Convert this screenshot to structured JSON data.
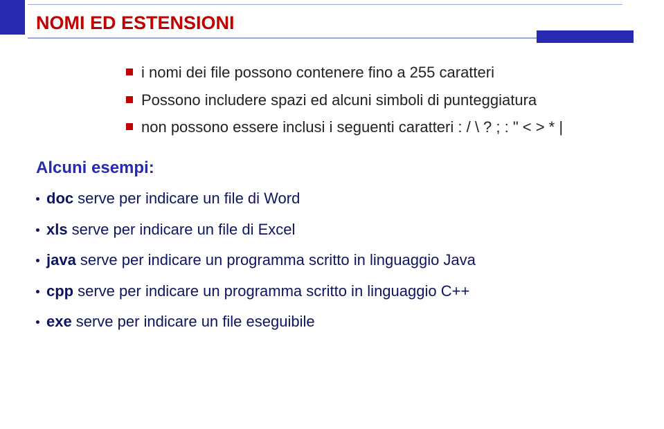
{
  "title": "NOMI ED ESTENSIONI",
  "bullets": [
    "i nomi dei file possono contenere fino a 255 caratteri",
    "Possono includere spazi ed alcuni simboli di punteggiatura",
    "non possono essere inclusi i seguenti caratteri :  / \\ ? ; : \" < > * |"
  ],
  "subheading": "Alcuni esempi:",
  "extensions": [
    {
      "name": "doc",
      "desc": "serve per indicare un file di Word"
    },
    {
      "name": "xls",
      "desc": "serve per indicare un file di Excel"
    },
    {
      "name": "java",
      "desc": "serve per indicare un programma scritto in linguaggio Java"
    },
    {
      "name": "cpp",
      "desc": "serve per indicare un programma scritto in linguaggio C++"
    },
    {
      "name": "exe",
      "desc": "serve per indicare un file eseguibile"
    }
  ]
}
